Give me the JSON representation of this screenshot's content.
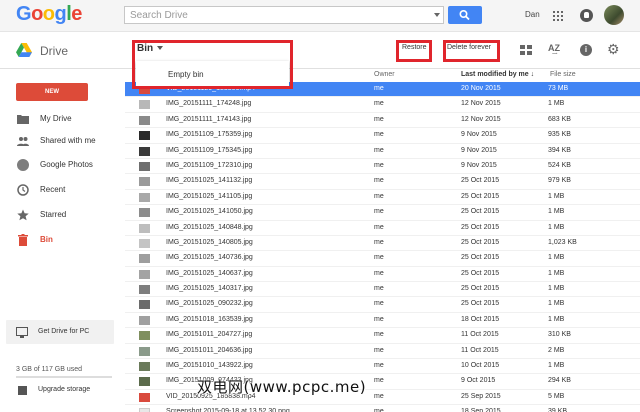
{
  "header": {
    "logo_letters": [
      {
        "ch": "G",
        "color": "#4285f4"
      },
      {
        "ch": "o",
        "color": "#ea4335"
      },
      {
        "ch": "o",
        "color": "#fbbc05"
      },
      {
        "ch": "g",
        "color": "#4285f4"
      },
      {
        "ch": "l",
        "color": "#34a853"
      },
      {
        "ch": "e",
        "color": "#ea4335"
      }
    ],
    "search_placeholder": "Search Drive",
    "user_name": "Dan"
  },
  "toolbar": {
    "app_title": "Drive",
    "folder_label": "Bin",
    "restore_label": "Restore",
    "delete_label": "Delete forever",
    "dropdown_item": "Empty bin"
  },
  "sidebar": {
    "new_label": "NEW",
    "items": [
      {
        "label": "My Drive",
        "icon": "my-drive-icon"
      },
      {
        "label": "Shared with me",
        "icon": "shared-icon"
      },
      {
        "label": "Google Photos",
        "icon": "photos-icon"
      },
      {
        "label": "Recent",
        "icon": "clock-icon"
      },
      {
        "label": "Starred",
        "icon": "star-icon"
      },
      {
        "label": "Bin",
        "icon": "bin-icon"
      }
    ],
    "get_drive_label": "Get Drive for PC",
    "storage_text": "3 GB of 117 GB used",
    "upgrade_label": "Upgrade storage"
  },
  "list": {
    "col_owner": "Owner",
    "col_modified": "Last modified by me",
    "col_size": "File size",
    "rows": [
      {
        "name": "VID_20151120_183806.mp4",
        "owner": "me",
        "date": "20 Nov 2015",
        "size": "73 MB"
      },
      {
        "name": "IMG_20151111_174248.jpg",
        "owner": "me",
        "date": "12 Nov 2015",
        "size": "1 MB"
      },
      {
        "name": "IMG_20151111_174143.jpg",
        "owner": "me",
        "date": "12 Nov 2015",
        "size": "683 KB"
      },
      {
        "name": "IMG_20151109_175359.jpg",
        "owner": "me",
        "date": "9 Nov 2015",
        "size": "935 KB"
      },
      {
        "name": "IMG_20151109_175345.jpg",
        "owner": "me",
        "date": "9 Nov 2015",
        "size": "394 KB"
      },
      {
        "name": "IMG_20151109_172310.jpg",
        "owner": "me",
        "date": "9 Nov 2015",
        "size": "524 KB"
      },
      {
        "name": "IMG_20151025_141132.jpg",
        "owner": "me",
        "date": "25 Oct 2015",
        "size": "979 KB"
      },
      {
        "name": "IMG_20151025_141105.jpg",
        "owner": "me",
        "date": "25 Oct 2015",
        "size": "1 MB"
      },
      {
        "name": "IMG_20151025_141050.jpg",
        "owner": "me",
        "date": "25 Oct 2015",
        "size": "1 MB"
      },
      {
        "name": "IMG_20151025_140848.jpg",
        "owner": "me",
        "date": "25 Oct 2015",
        "size": "1 MB"
      },
      {
        "name": "IMG_20151025_140805.jpg",
        "owner": "me",
        "date": "25 Oct 2015",
        "size": "1,023 KB"
      },
      {
        "name": "IMG_20151025_140736.jpg",
        "owner": "me",
        "date": "25 Oct 2015",
        "size": "1 MB"
      },
      {
        "name": "IMG_20151025_140637.jpg",
        "owner": "me",
        "date": "25 Oct 2015",
        "size": "1 MB"
      },
      {
        "name": "IMG_20151025_140317.jpg",
        "owner": "me",
        "date": "25 Oct 2015",
        "size": "1 MB"
      },
      {
        "name": "IMG_20151025_090232.jpg",
        "owner": "me",
        "date": "25 Oct 2015",
        "size": "1 MB"
      },
      {
        "name": "IMG_20151018_163539.jpg",
        "owner": "me",
        "date": "18 Oct 2015",
        "size": "1 MB"
      },
      {
        "name": "IMG_20151011_204727.jpg",
        "owner": "me",
        "date": "11 Oct 2015",
        "size": "310 KB"
      },
      {
        "name": "IMG_20151011_204636.jpg",
        "owner": "me",
        "date": "11 Oct 2015",
        "size": "2 MB"
      },
      {
        "name": "IMG_20151010_143922.jpg",
        "owner": "me",
        "date": "10 Oct 2015",
        "size": "1 MB"
      },
      {
        "name": "IMG_20151009_074433.jpg",
        "owner": "me",
        "date": "9 Oct 2015",
        "size": "294 KB"
      },
      {
        "name": "VID_20150925_185838.mp4",
        "owner": "me",
        "date": "25 Sep 2015",
        "size": "5 MB"
      },
      {
        "name": "Screenshot 2015-09-18 at 13.52.30.png",
        "owner": "me",
        "date": "18 Sep 2015",
        "size": "39 KB"
      }
    ]
  },
  "watermark": "双电网(www.pcpc.me)"
}
